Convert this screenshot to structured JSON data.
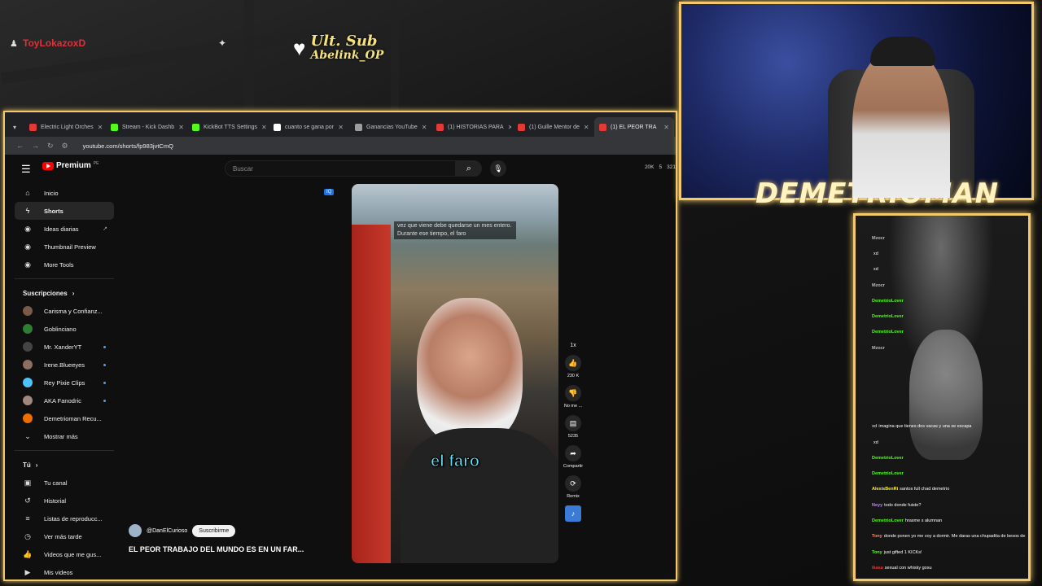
{
  "overlay": {
    "alert_user": "ToyLokazoxD",
    "ult_sub_title": "Ult. Sub",
    "ult_sub_name": "Abelink_OP",
    "cam_label": "DEMETRIOMAN"
  },
  "browser": {
    "tabs": [
      {
        "label": "Electric Light Orches",
        "color": "#e53935"
      },
      {
        "label": "Stream - Kick Dashb",
        "color": "#53fc18"
      },
      {
        "label": "KickBot TTS Settings",
        "color": "#53fc18"
      },
      {
        "label": "cuanto se gana por",
        "color": "#ffffff"
      },
      {
        "label": "Ganancias YouTube",
        "color": "#9e9e9e"
      },
      {
        "label": "(1) HISTORIAS PARA",
        "color": "#e53935"
      },
      {
        "label": "(1) Guille Mentor de",
        "color": "#e53935"
      },
      {
        "label": "(1) EL PEOR TRA",
        "color": "#e53935"
      }
    ],
    "url": "youtube.com/shorts/fp983jvtCmQ"
  },
  "yt": {
    "logo_word": "Premium",
    "logo_pe": "PE",
    "search_placeholder": "Buscar",
    "stats": [
      "20K",
      "5",
      "321"
    ],
    "sidebar_main": [
      {
        "label": "Inicio",
        "icon": "home-icon"
      },
      {
        "label": "Shorts",
        "icon": "shorts-icon",
        "active": true
      },
      {
        "label": "Ideas diarias",
        "icon": "bulb-icon",
        "ext": true
      },
      {
        "label": "Thumbnail Preview",
        "icon": "image-icon"
      },
      {
        "label": "More Tools",
        "icon": "tools-icon"
      }
    ],
    "subs_heading": "Suscripciones",
    "subscriptions": [
      {
        "label": "Carisma y Confianz...",
        "color": "#7b5a4a",
        "dot": false
      },
      {
        "label": "Goblinciano",
        "color": "#2e7d32",
        "dot": false
      },
      {
        "label": "Mr. XanderYT",
        "color": "#444444",
        "dot": true
      },
      {
        "label": "Irene.Blueeyes",
        "color": "#8d6e63",
        "dot": true
      },
      {
        "label": "Rey Pixie Clips",
        "color": "#4fc3f7",
        "dot": true
      },
      {
        "label": "AKA Fanodric",
        "color": "#a1887f",
        "dot": true
      },
      {
        "label": "Demetrioman Recu...",
        "color": "#ef6c00",
        "dot": false
      }
    ],
    "show_more": "Mostrar más",
    "you_heading": "Tú",
    "you_items": [
      {
        "label": "Tu canal",
        "icon": "channel-icon"
      },
      {
        "label": "Historial",
        "icon": "history-icon"
      },
      {
        "label": "Listas de reproducc...",
        "icon": "playlist-icon"
      },
      {
        "label": "Ver más tarde",
        "icon": "clock-icon"
      },
      {
        "label": "Videos que me gus...",
        "icon": "like-icon"
      },
      {
        "label": "Mis videos",
        "icon": "video-icon"
      }
    ],
    "short": {
      "caption_top": "vez que viene debe quedarse un mes entero. Durante ese tiempo, el faro",
      "caption_big": "el faro",
      "channel": "@DanElCurioso",
      "subscribe": "Suscribirme",
      "title": "EL PEOR TRABAJO DEL MUNDO ES EN UN FAR...",
      "speed": "1x",
      "likes": "230 K",
      "dislike": "No me ...",
      "comments": "5235",
      "share": "Compartir",
      "remix": "Remix",
      "iq": "IQ"
    }
  },
  "chat": {
    "messages": [
      {
        "user": "Mzocr",
        "text": "",
        "color": "#bbbbbb"
      },
      {
        "user": "",
        "text": "xd",
        "color": "#bbbbbb"
      },
      {
        "user": "",
        "text": "xd",
        "color": "#bbbbbb"
      },
      {
        "user": "Mzocr",
        "text": "",
        "color": "#bbbbbb"
      },
      {
        "user": "DemetrioLover",
        "text": "",
        "color": "#53fc18"
      },
      {
        "user": "DemetrioLover",
        "text": "",
        "color": "#53fc18"
      },
      {
        "user": "DemetrioLover",
        "text": "",
        "color": "#53fc18"
      },
      {
        "user": "Mzocr",
        "text": "",
        "color": "#bbbbbb"
      },
      {
        "user": "",
        "text": "",
        "color": "#e53935"
      },
      {
        "user": "",
        "text": "",
        "color": "#e53935"
      },
      {
        "user": "",
        "text": "",
        "color": "#e53935"
      },
      {
        "user": "",
        "text": "",
        "color": "#e53935"
      },
      {
        "user": "xd",
        "text": "imagina que tienes dos vacas y una se escapa",
        "color": "#bbbbbb"
      },
      {
        "user": "",
        "text": "xd",
        "color": "#bbbbbb"
      },
      {
        "user": "DemetrioLover",
        "text": "",
        "color": "#53fc18"
      },
      {
        "user": "DemetrioLover",
        "text": "",
        "color": "#53fc18"
      },
      {
        "user": "AlexisBenRi",
        "text": "santos full chad demetrio",
        "color": "#ffeb3b"
      },
      {
        "user": "Neyy",
        "text": "todo donde fuiste?",
        "color": "#bb86fc"
      },
      {
        "user": "DemetrioLover",
        "text": "hrasme s alumnan",
        "color": "#53fc18"
      },
      {
        "user": "Tony",
        "text": "donde ponen yo me voy a dormir. Me daras una chupadita de besos de abuela?",
        "color": "#ff8a65"
      },
      {
        "user": "Tony",
        "text": "just gifted 1 KICKs!",
        "color": "#53fc18"
      },
      {
        "user": "ikasa",
        "text": "sexual con whisky gosu",
        "color": "#e53935"
      }
    ]
  }
}
